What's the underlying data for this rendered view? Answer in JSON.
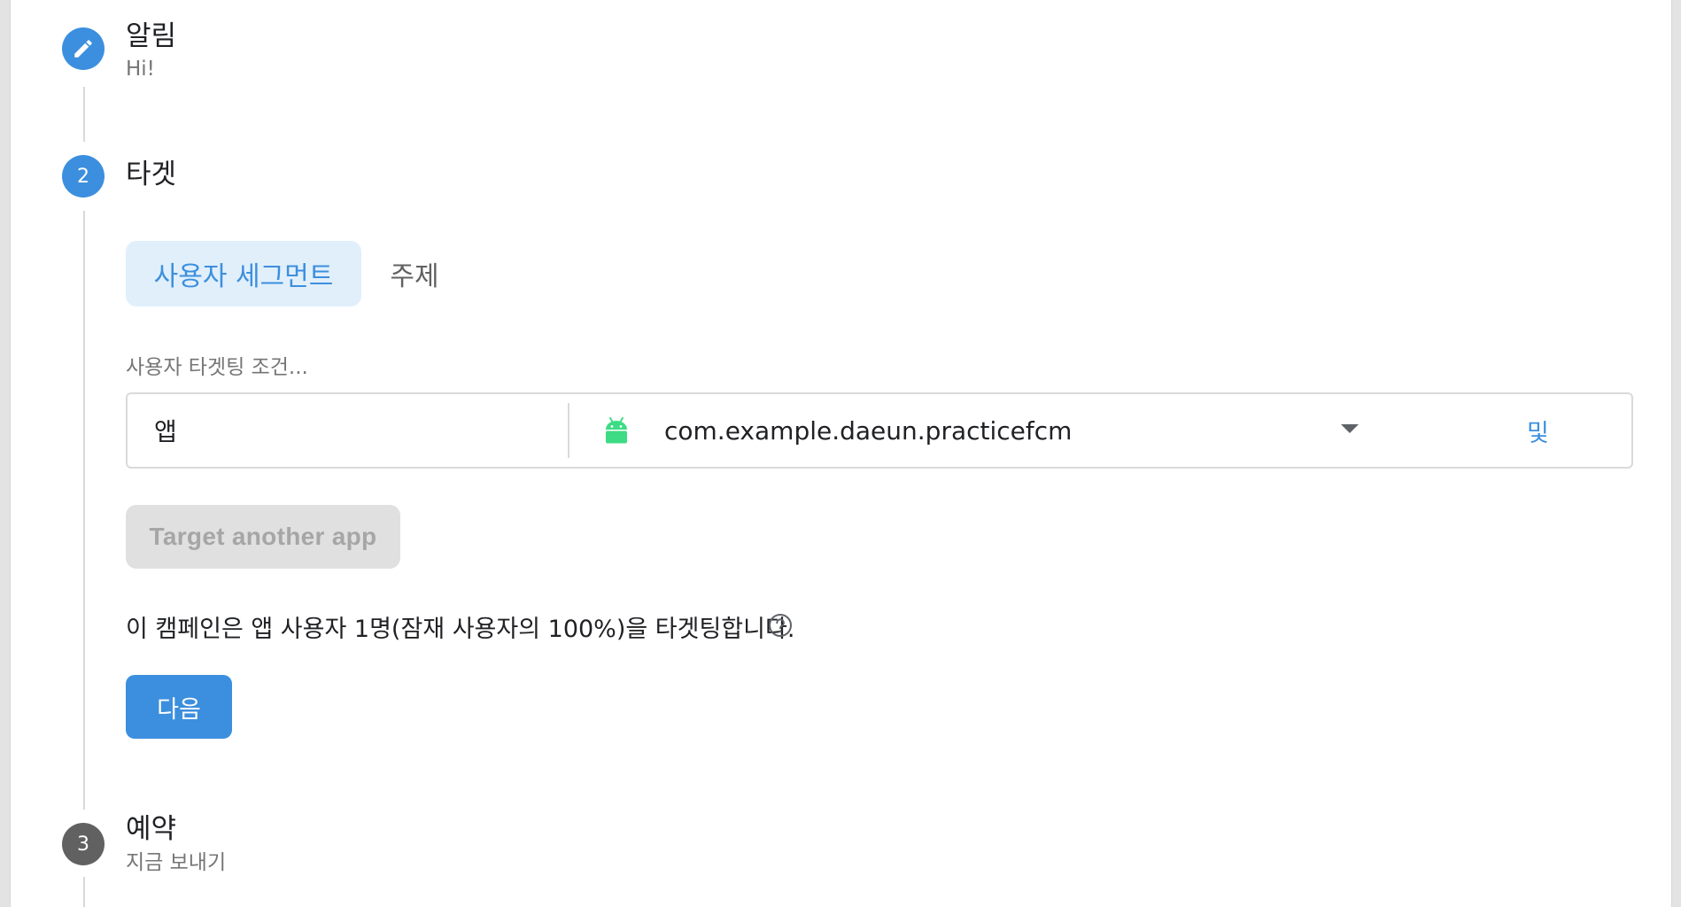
{
  "steps": {
    "notification": {
      "title": "알림",
      "subtitle": "Hi!",
      "icon": "pencil-icon"
    },
    "target": {
      "number": "2",
      "title": "타겟",
      "tabs": {
        "user_segment": "사용자 세그먼트",
        "topic": "주제"
      },
      "condition_label": "사용자 타겟팅 조건...",
      "condition_row": {
        "field": "앱",
        "app_id": "com.example.daeun.practicefcm",
        "platform_icon": "android-icon",
        "and_label": "및"
      },
      "target_another_app": "Target another app",
      "reach_text": "이 캠페인은 앱 사용자 1명(잠재 사용자의 100%)을 타겟팅합니다.",
      "next_button": "다음"
    },
    "schedule": {
      "number": "3",
      "title": "예약",
      "subtitle": "지금 보내기"
    }
  },
  "colors": {
    "accent": "#3c8fde",
    "accent_light": "#e1effb",
    "android": "#3ddc84",
    "inactive_step": "#616161",
    "disabled_button": "#e0e0e0"
  }
}
